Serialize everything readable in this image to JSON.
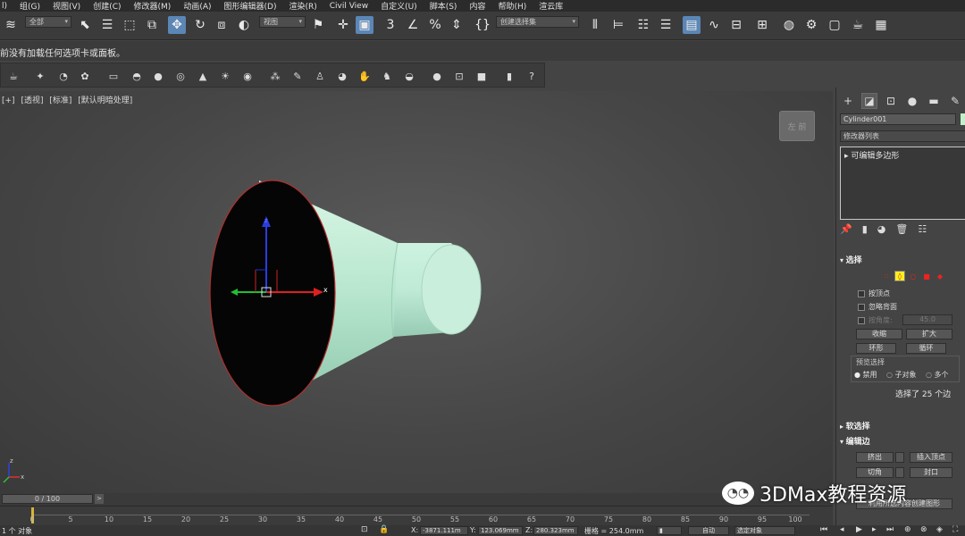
{
  "menu": [
    "l)",
    "组(G)",
    "视图(V)",
    "创建(C)",
    "修改器(M)",
    "动画(A)",
    "图形编辑器(D)",
    "渲染(R)",
    "Civil View",
    "自定义(U)",
    "脚本(S)",
    "内容",
    "帮助(H)",
    "渲云库"
  ],
  "toolbar": {
    "selection_filter": "全部",
    "ref_coord": "视图",
    "named_sel_placeholder": "创建选择集"
  },
  "prompt_text": "前没有加载任何选项卡或面板。",
  "viewport": {
    "label_plus": "[+]",
    "label_view": "[透视]",
    "label_shading": "[标准]",
    "label_lighting": "[默认明暗处理]",
    "viewcube_text": "左  前",
    "gizmo_z": "z",
    "gizmo_x": "x",
    "axis_x": "x",
    "axis_z": "z"
  },
  "command_panel": {
    "object_name": "Cylinder001",
    "object_color": "#c2eec9",
    "modifier_list": "修改器列表",
    "stack_item": "可编辑多边形",
    "selection_rollout": "选择",
    "by_vertex": "按顶点",
    "ignore_backfacing": "忽略背面",
    "by_angle": "按角度:",
    "angle_value": "45.0",
    "shrink": "收缩",
    "grow": "扩大",
    "ring": "环形",
    "loop": "循环",
    "preview_selection": "预览选择",
    "off": "禁用",
    "sub_object": "子对象",
    "multi": "多个",
    "selection_status": "选择了 25 个边",
    "soft_selection": "软选择",
    "edit_edges": "编辑边",
    "extrude": "挤出",
    "insert_vertex": "插入顶点",
    "chamfer": "切角",
    "cap": "封口",
    "create_shape": "利用所选内容创建图形"
  },
  "timeline": {
    "slider": "0 / 100",
    "ticks": [
      "0",
      "5",
      "10",
      "15",
      "20",
      "25",
      "30",
      "35",
      "40",
      "45",
      "50",
      "55",
      "60",
      "65",
      "70",
      "75",
      "80",
      "85",
      "90",
      "95",
      "100"
    ]
  },
  "status": {
    "left": "1 个 对象",
    "x_label": "X:",
    "x_value": "-3871.111m",
    "y_label": "Y:",
    "y_value": "123.069mm",
    "z_label": "Z:",
    "z_value": "280.323mm",
    "grid": "栅格 = 254.0mm",
    "auto_key": "自动",
    "selected_object": "选定对象"
  },
  "watermark": "3DMax教程资源"
}
